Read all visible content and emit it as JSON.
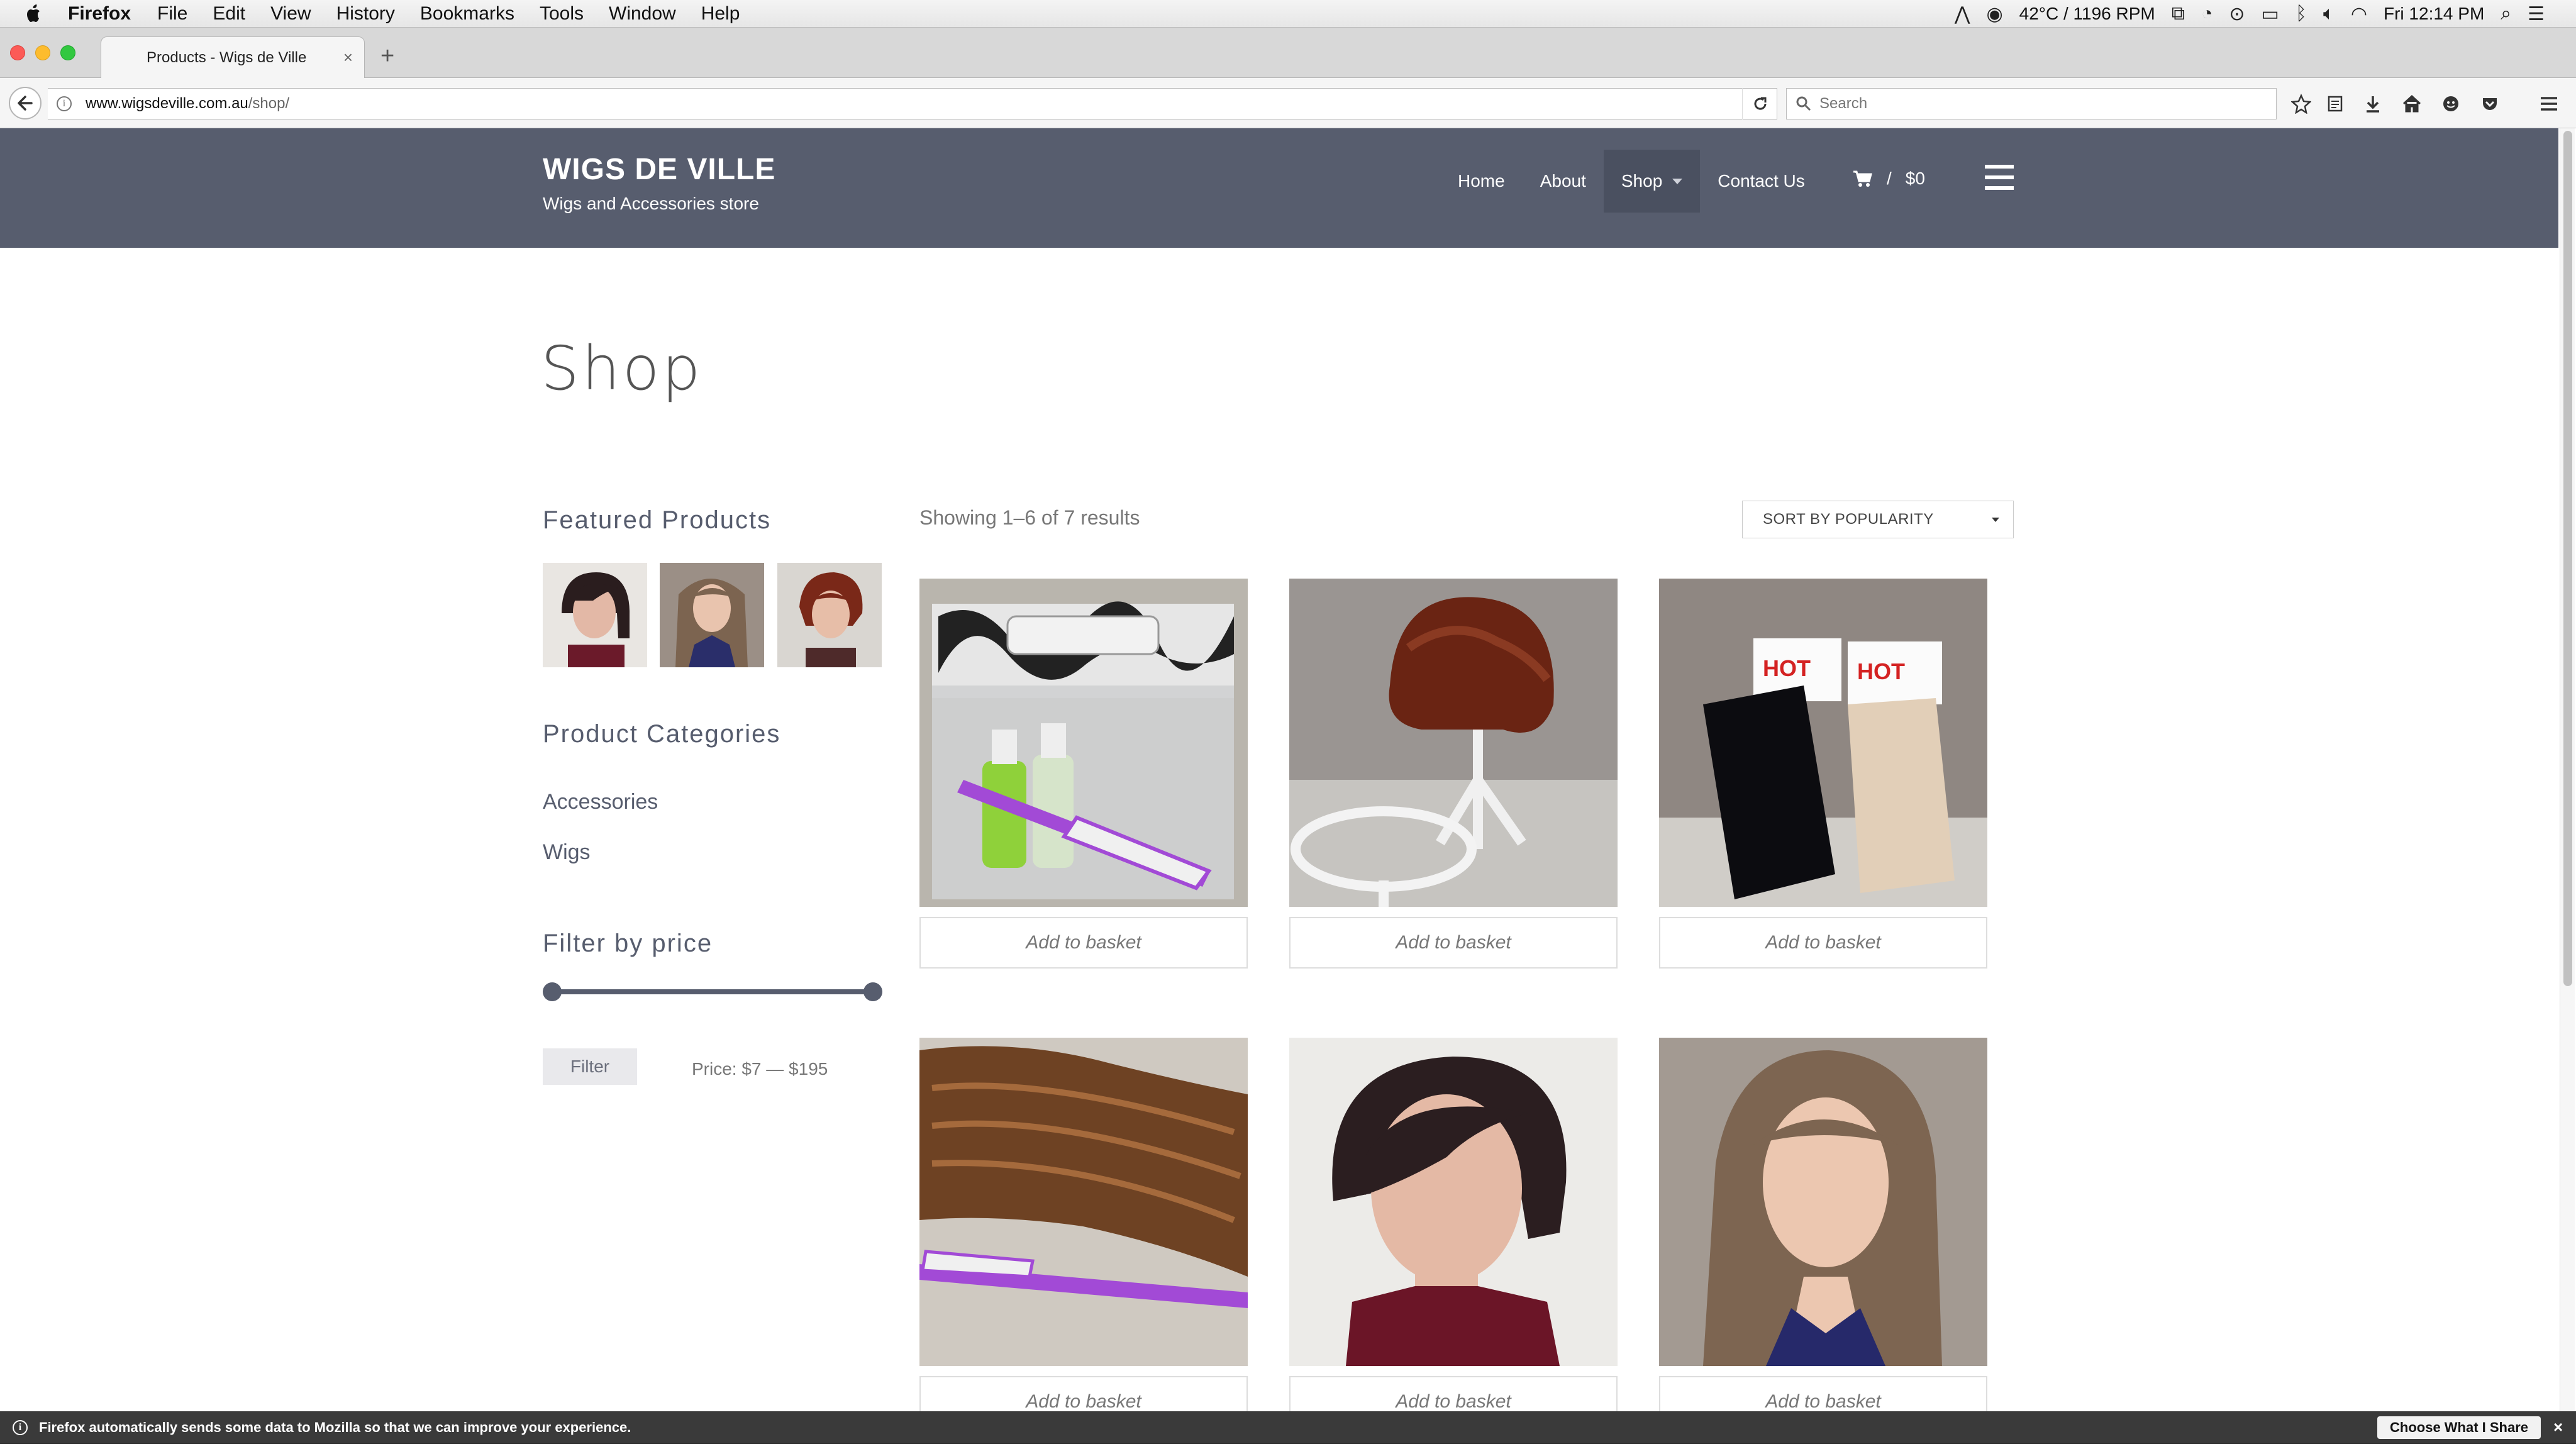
{
  "menubar": {
    "app_name": "Firefox",
    "items": [
      "File",
      "Edit",
      "View",
      "History",
      "Bookmarks",
      "Tools",
      "Window",
      "Help"
    ],
    "status": {
      "temp_fan": "42°C / 1196 RPM",
      "clock": "Fri 12:14 PM"
    }
  },
  "browser": {
    "tab_title": "Products - Wigs de Ville",
    "url_domain": "www.wigsdeville.com.au",
    "url_path": "/shop/",
    "search_placeholder": "Search"
  },
  "site": {
    "title": "WIGS DE VILLE",
    "tagline": "Wigs and Accessories store",
    "nav": [
      {
        "label": "Home"
      },
      {
        "label": "About"
      },
      {
        "label": "Shop"
      },
      {
        "label": "Contact Us"
      }
    ],
    "cart_total": "$0",
    "cart_separator": "/"
  },
  "page": {
    "title": "Shop",
    "result_count": "Showing 1–6 of 7 results",
    "orderby_selected": "SORT BY POPULARITY"
  },
  "sidebar": {
    "featured_title": "Featured Products",
    "categories_title": "Product Categories",
    "categories": [
      "Accessories",
      "Wigs"
    ],
    "filter_title": "Filter by price",
    "filter_button": "Filter",
    "price_range_label": "Price: $7 — $195",
    "price_min_fraction": 0.0,
    "price_max_fraction": 1.0
  },
  "products": [
    {
      "button": "Add to basket",
      "image": "accessory-bag-spray-brush"
    },
    {
      "button": "Add to basket",
      "image": "auburn-wig-on-stand"
    },
    {
      "button": "Add to basket",
      "image": "hotlocks-wig-caps"
    },
    {
      "button": "Add to basket",
      "image": "brown-hair-piece-brush"
    },
    {
      "button": "Add to basket",
      "image": "dark-bob-wig-model"
    },
    {
      "button": "Add to basket",
      "image": "long-brown-wig-model"
    }
  ],
  "notification": {
    "text": "Firefox automatically sends some data to Mozilla so that we can improve your experience.",
    "button": "Choose What I Share"
  }
}
